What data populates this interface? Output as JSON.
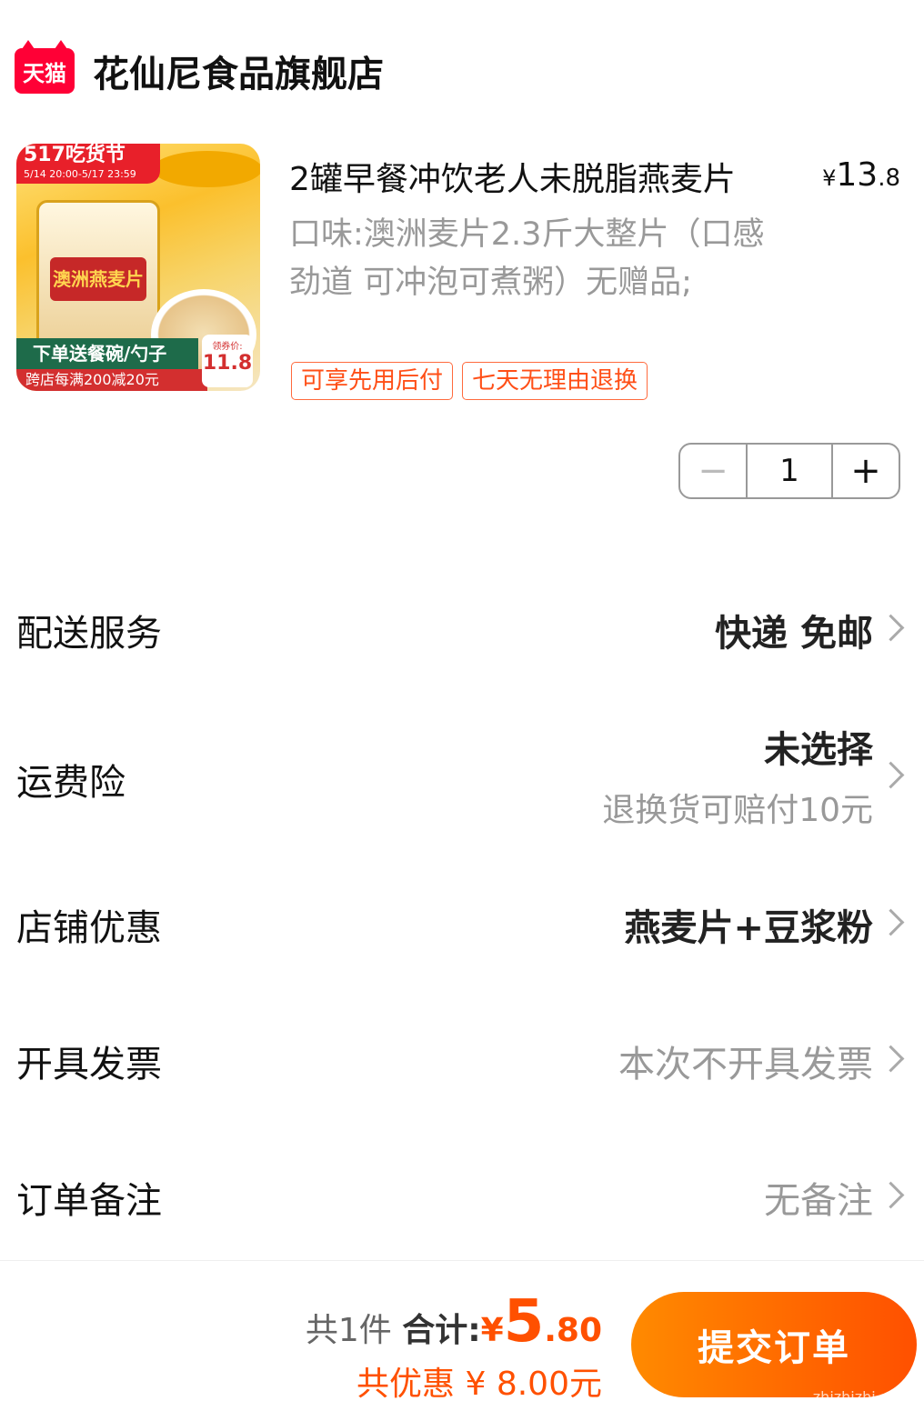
{
  "store": {
    "logo_text": "天猫",
    "name": "花仙尼食品旗舰店"
  },
  "product": {
    "title": "2罐早餐冲饮老人未脱脂燕麦片",
    "price_symbol": "¥",
    "price_int": "13",
    "price_dec": ".8",
    "spec": "口味:澳洲麦片2.3斤大整片（口感劲道 可冲泡可煮粥）无赠品;",
    "tags": [
      "可享先用后付",
      "七天无理由退换"
    ],
    "image": {
      "banner": "517吃货节",
      "banner_time": "5/14 20:00-5/17 23:59",
      "jar_label": "澳洲燕麦片",
      "strip": "下单送餐碗/勺子",
      "strip2": "跨店每满200减20元",
      "price_caption": "领券价:",
      "price": "11.8"
    },
    "quantity": "1",
    "minus": "−",
    "plus": "+"
  },
  "rows": {
    "delivery": {
      "label": "配送服务",
      "value": "快递 免邮"
    },
    "insurance": {
      "label": "运费险",
      "value": "未选择",
      "sub": "退换货可赔付10元"
    },
    "discount": {
      "label": "店铺优惠",
      "value": "燕麦片+豆浆粉"
    },
    "invoice": {
      "label": "开具发票",
      "value": "本次不开具发票"
    },
    "note": {
      "label": "订单备注",
      "value": "无备注"
    }
  },
  "summary": {
    "count": "共1件",
    "total_label": "合计:",
    "currency": "¥",
    "total_int": "5",
    "total_dec": ".80",
    "saving": "共优惠 ¥ 8.00元",
    "submit": "提交订单"
  },
  "watermark": "zhizhizhi.com",
  "colors": {
    "accent": "#ff5000",
    "tmall": "#ff0036"
  }
}
